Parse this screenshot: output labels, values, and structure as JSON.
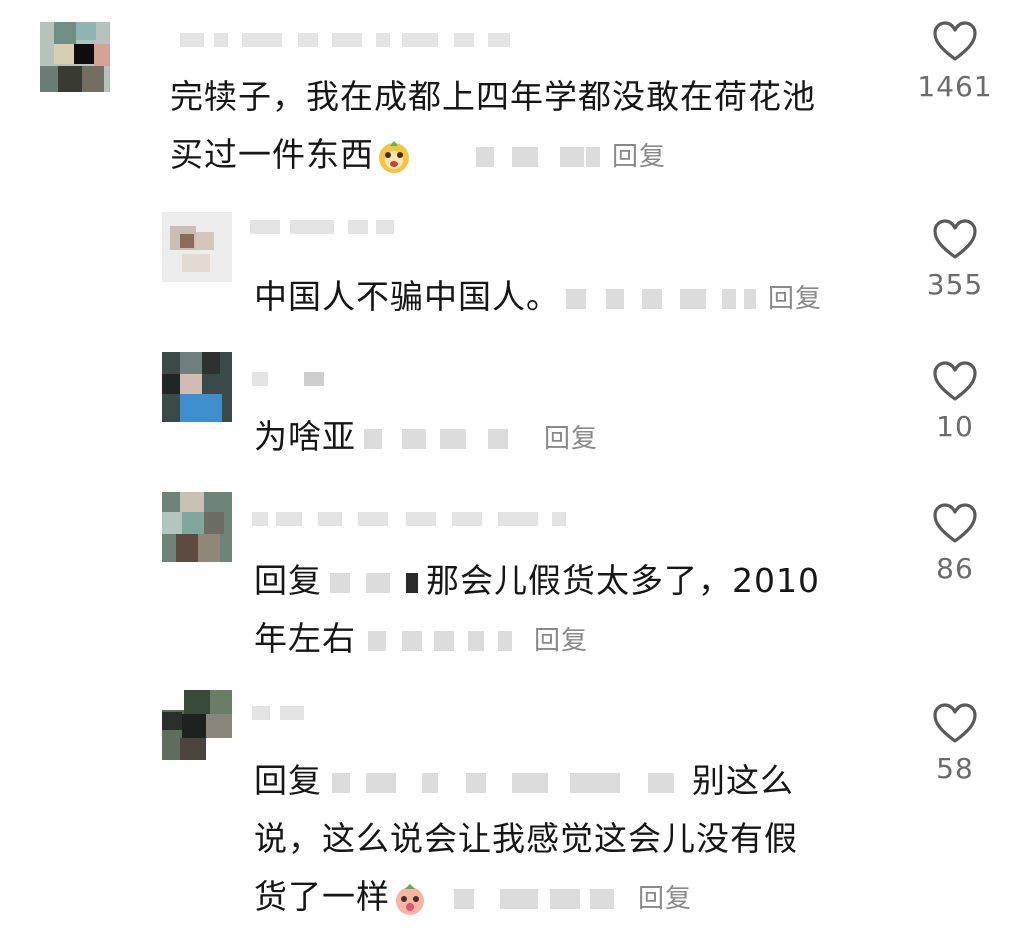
{
  "comments": [
    {
      "text_lines": [
        "完犊子，我在成都上四年学都没敢在荷花池",
        "买过一件东西"
      ],
      "reply_label": "回复",
      "likes": "1461",
      "emoji": "dog-emoji"
    },
    {
      "text_lines": [
        "中国人不骗中国人。"
      ],
      "reply_label": "回复",
      "likes": "355"
    },
    {
      "text_lines": [
        "为啥亚"
      ],
      "reply_label": "回复",
      "likes": "10"
    },
    {
      "text_lines": [
        "回复",
        "那会儿假货太多了，2010",
        "年左右"
      ],
      "reply_label": "回复",
      "likes": "86"
    },
    {
      "text_lines": [
        "回复",
        "别这么",
        "说，这么说会让我感觉这会儿没有假",
        "货了一样"
      ],
      "reply_label": "回复",
      "likes": "58",
      "emoji": "peach-emoji"
    }
  ],
  "colors": {
    "text": "#161616",
    "meta": "#8a8a8a",
    "heart": "#5a5a5a"
  }
}
